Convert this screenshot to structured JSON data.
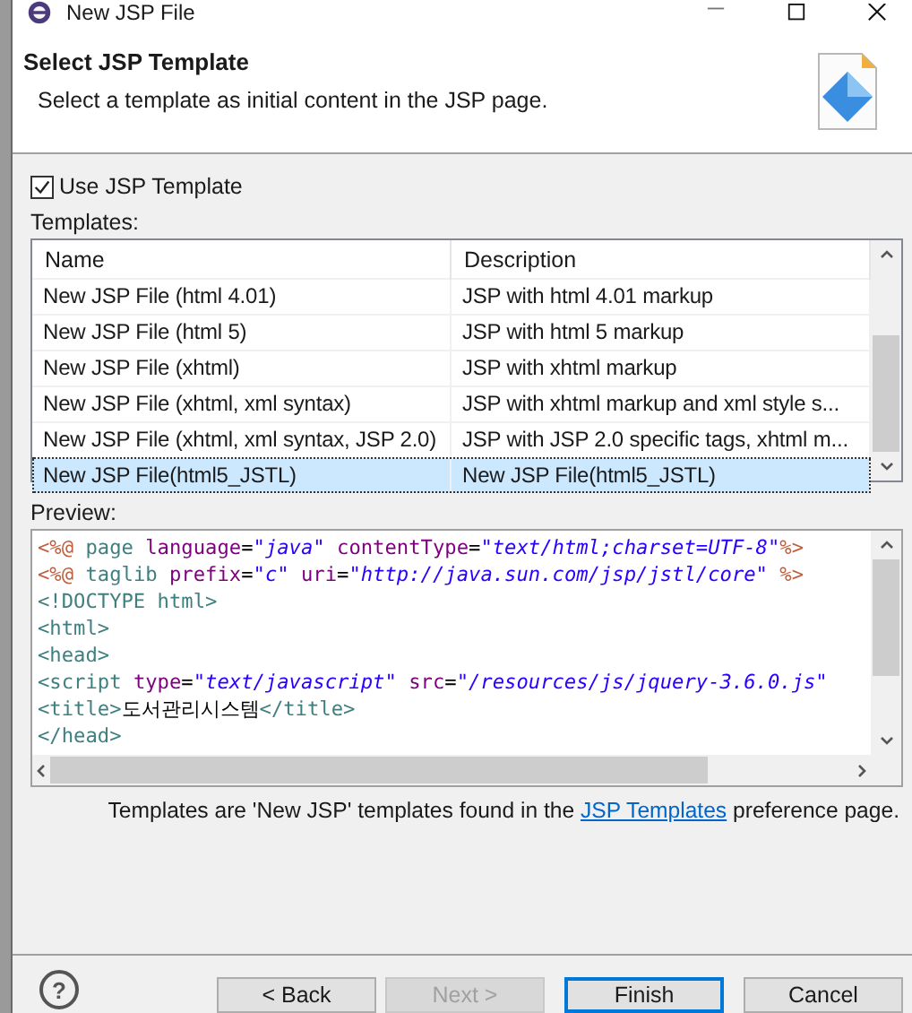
{
  "window": {
    "title": "New JSP File"
  },
  "header": {
    "title": "Select JSP Template",
    "description": "Select a template as initial content in the JSP page."
  },
  "use_template": {
    "label": "Use JSP Template",
    "checked": true
  },
  "templates": {
    "label": "Templates:",
    "columns": [
      "Name",
      "Description"
    ],
    "rows": [
      {
        "name": "New JSP File (html 4.01)",
        "description": "JSP with html 4.01 markup",
        "selected": false
      },
      {
        "name": "New JSP File (html 5)",
        "description": "JSP with html 5 markup",
        "selected": false
      },
      {
        "name": "New JSP File (xhtml)",
        "description": "JSP with xhtml markup",
        "selected": false
      },
      {
        "name": "New JSP File (xhtml, xml syntax)",
        "description": "JSP with xhtml markup and xml style s...",
        "selected": false
      },
      {
        "name": "New JSP File (xhtml, xml syntax, JSP 2.0)",
        "description": "JSP with JSP 2.0 specific tags, xhtml m...",
        "selected": false
      },
      {
        "name": "New JSP File(html5_JSTL)",
        "description": "New JSP File(html5_JSTL)",
        "selected": true
      }
    ]
  },
  "preview": {
    "label": "Preview:",
    "lines": [
      [
        {
          "kind": "delim",
          "text": "<%@"
        },
        {
          "kind": "tag",
          "text": " page"
        },
        {
          "kind": "attr",
          "text": " language"
        },
        {
          "kind": "plain",
          "text": "="
        },
        {
          "kind": "value",
          "text": "\"java\""
        },
        {
          "kind": "attr",
          "text": " contentType"
        },
        {
          "kind": "plain",
          "text": "="
        },
        {
          "kind": "value",
          "text": "\"text/html;charset=UTF-8\""
        },
        {
          "kind": "delim",
          "text": "%>"
        }
      ],
      [
        {
          "kind": "delim",
          "text": "<%@"
        },
        {
          "kind": "tag",
          "text": " taglib"
        },
        {
          "kind": "attr",
          "text": " prefix"
        },
        {
          "kind": "plain",
          "text": "="
        },
        {
          "kind": "value",
          "text": "\"c\""
        },
        {
          "kind": "attr",
          "text": " uri"
        },
        {
          "kind": "plain",
          "text": "="
        },
        {
          "kind": "value",
          "text": "\"http://java.sun.com/jsp/jstl/core\""
        },
        {
          "kind": "delim",
          "text": " %>"
        }
      ],
      [
        {
          "kind": "tag",
          "text": "<!DOCTYPE html>"
        }
      ],
      [
        {
          "kind": "tag",
          "text": "<html>"
        }
      ],
      [
        {
          "kind": "tag",
          "text": "<head>"
        }
      ],
      [
        {
          "kind": "tag",
          "text": "<script"
        },
        {
          "kind": "attr",
          "text": " type"
        },
        {
          "kind": "plain",
          "text": "="
        },
        {
          "kind": "value",
          "text": "\"text/javascript\""
        },
        {
          "kind": "attr",
          "text": " src"
        },
        {
          "kind": "plain",
          "text": "="
        },
        {
          "kind": "value",
          "text": "\"/resources/js/jquery-3.6.0.js\""
        }
      ],
      [
        {
          "kind": "tag",
          "text": "<title>"
        },
        {
          "kind": "plain",
          "text": "도서관리시스템"
        },
        {
          "kind": "tag",
          "text": "</title>"
        }
      ],
      [
        {
          "kind": "tag",
          "text": "</head>"
        }
      ]
    ]
  },
  "note": {
    "before": "Templates are 'New JSP' templates found in the ",
    "link": "JSP Templates",
    "after": " preference page."
  },
  "help": {
    "symbol": "?"
  },
  "buttons": [
    {
      "label": "< Back",
      "disabled": false,
      "default": false
    },
    {
      "label": "Next >",
      "disabled": true,
      "default": false
    },
    {
      "label": "Finish",
      "disabled": false,
      "default": true
    },
    {
      "label": "Cancel",
      "disabled": false,
      "default": false
    }
  ]
}
